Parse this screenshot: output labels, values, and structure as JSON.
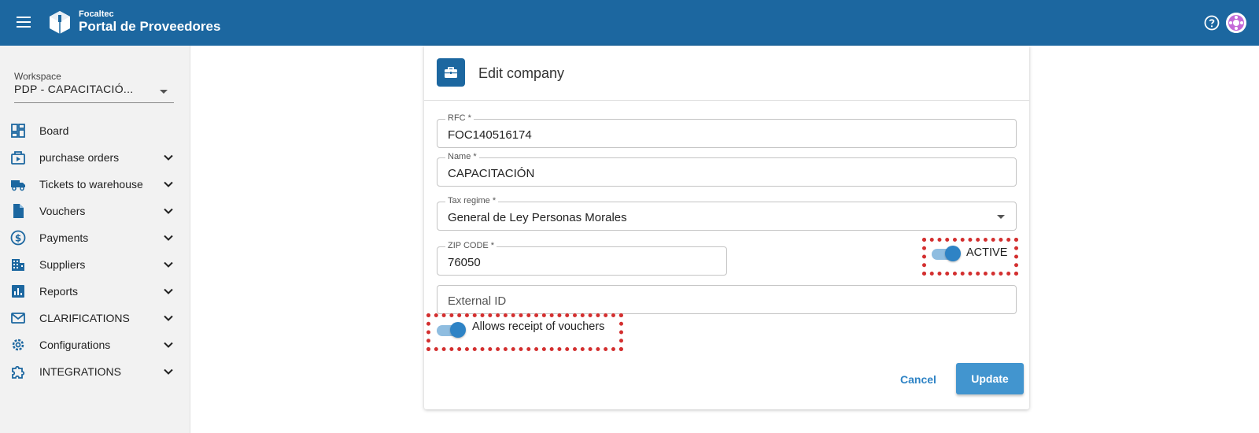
{
  "header": {
    "brand_small": "Focaltec",
    "brand_title": "Portal de Proveedores",
    "icons": [
      "menu-icon",
      "logo-icon",
      "help-icon",
      "user-avatar"
    ]
  },
  "sidebar": {
    "workspace_label": "Workspace",
    "workspace_value": "PDP - CAPACITACIÓ...",
    "items": [
      {
        "label": "Board",
        "icon": "dashboard-icon",
        "expandable": false
      },
      {
        "label": "purchase orders",
        "icon": "purchase-orders-icon",
        "expandable": true
      },
      {
        "label": "Tickets to warehouse",
        "icon": "truck-icon",
        "expandable": true
      },
      {
        "label": "Vouchers",
        "icon": "document-icon",
        "expandable": true
      },
      {
        "label": "Payments",
        "icon": "dollar-icon",
        "expandable": true
      },
      {
        "label": "Suppliers",
        "icon": "building-icon",
        "expandable": true
      },
      {
        "label": "Reports",
        "icon": "chart-icon",
        "expandable": true
      },
      {
        "label": "CLARIFICATIONS",
        "icon": "mail-icon",
        "expandable": true
      },
      {
        "label": "Configurations",
        "icon": "gear-icon",
        "expandable": true
      },
      {
        "label": "INTEGRATIONS",
        "icon": "puzzle-icon",
        "expandable": true
      }
    ]
  },
  "form": {
    "title": "Edit company",
    "rfc_label": "RFC *",
    "rfc_value": "FOC140516174",
    "name_label": "Name *",
    "name_value": "CAPACITACIÓN",
    "tax_label": "Tax regime *",
    "tax_value": "General de Ley Personas Morales",
    "zip_label": "ZIP CODE *",
    "zip_value": "76050",
    "active_label": "ACTIVE",
    "active_on": true,
    "external_placeholder": "External ID",
    "vouchers_label": "Allows receipt of vouchers",
    "vouchers_on": true,
    "cancel_label": "Cancel",
    "update_label": "Update"
  },
  "colors": {
    "primary": "#1c67a0",
    "accent": "#2e83c5",
    "highlight": "#d32f2f"
  }
}
